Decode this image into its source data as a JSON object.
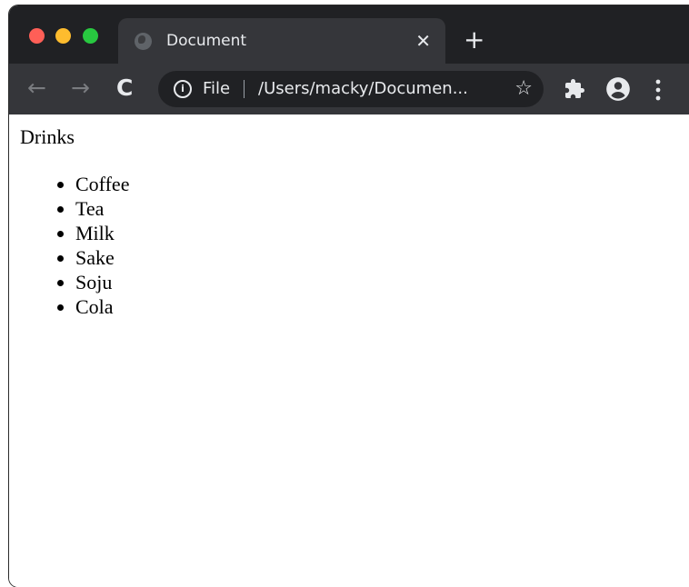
{
  "browser": {
    "tab": {
      "title": "Document",
      "close_glyph": "✕"
    },
    "new_tab_glyph": "+",
    "nav": {
      "back_glyph": "←",
      "forward_glyph": "→",
      "reload_glyph": "C"
    },
    "omnibox": {
      "info_glyph": "i",
      "scheme_label": "File",
      "url": "/Users/macky/Documen...",
      "star_glyph": "☆"
    },
    "icons": {
      "extensions": "puzzle-icon",
      "profile": "account-circle-icon",
      "menu": "kebab-menu-icon"
    },
    "colors": {
      "titlebar": "#202124",
      "toolbar": "#35363a",
      "close": "#ff5f57",
      "minimize": "#febc2e",
      "maximize": "#28c840"
    }
  },
  "page": {
    "heading": "Drinks",
    "items": [
      "Coffee",
      "Tea",
      "Milk",
      "Sake",
      "Soju",
      "Cola"
    ]
  }
}
